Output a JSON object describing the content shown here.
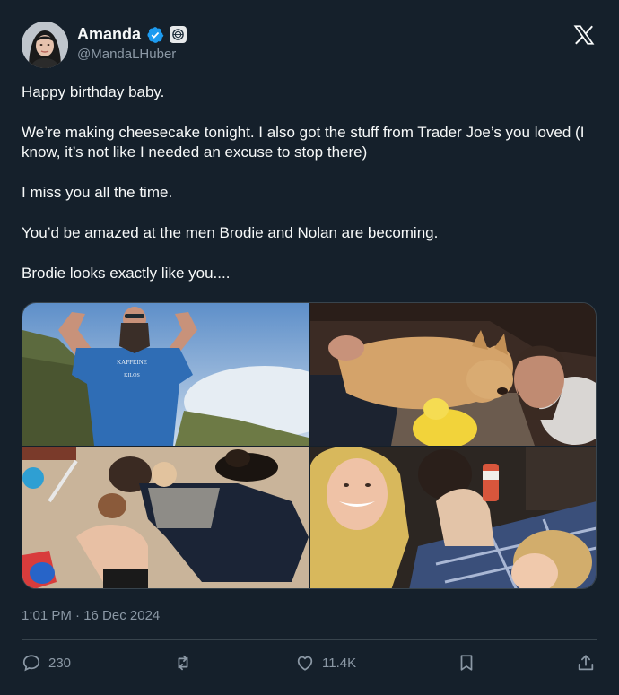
{
  "author": {
    "display_name": "Amanda",
    "handle": "@MandaLHuber",
    "avatar_icon": "profile-photo",
    "verified_color": "#1d9bf0"
  },
  "brand_icon": "x-logo-icon",
  "tweet": {
    "paragraphs": [
      "Happy birthday baby.",
      "We’re making cheesecake tonight. I also got the stuff from Trader Joe’s you loved (I know, it’s not like I needed an excuse to stop there)",
      "I miss you all the time.",
      "You’d be amazed at the men Brodie and Nolan are becoming.",
      "Brodie looks exactly like you...."
    ],
    "photos": [
      {
        "description_icon": "photo-man-flexing-on-mountain",
        "shirt_text": [
          "KAFFEINE",
          "KILOS"
        ]
      },
      {
        "description_icon": "photo-man-with-dog"
      },
      {
        "description_icon": "photo-family-on-floor"
      },
      {
        "description_icon": "photo-selfie-family"
      }
    ],
    "timestamp": "1:01 PM · 16 Dec 2024"
  },
  "actions": {
    "reply_count": "230",
    "retweet_count": "",
    "like_count": "11.4K",
    "icons": [
      "reply-icon",
      "retweet-icon",
      "like-icon",
      "bookmark-icon",
      "share-icon"
    ]
  },
  "colors": {
    "background": "#15202b",
    "text_primary": "#f7f9f9",
    "text_secondary": "#8b98a5",
    "border": "#38444d"
  }
}
